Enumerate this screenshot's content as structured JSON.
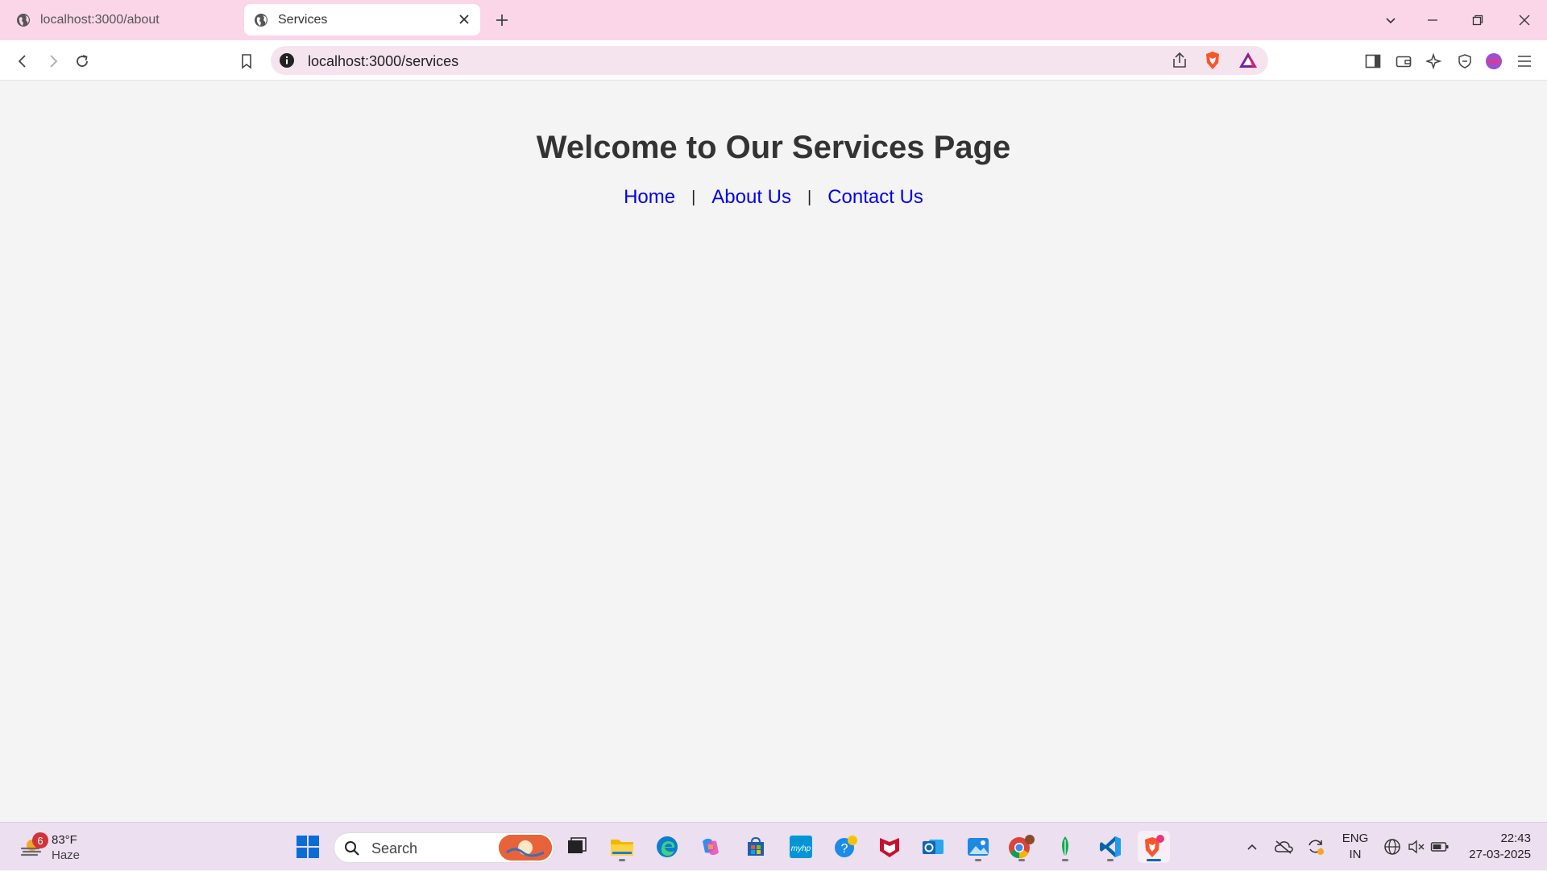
{
  "browser": {
    "tabs": [
      {
        "title": "localhost:3000/about",
        "active": false
      },
      {
        "title": "Services",
        "active": true
      }
    ],
    "address_bar": {
      "url": "localhost:3000/services"
    }
  },
  "page": {
    "heading": "Welcome to Our Services Page",
    "nav": {
      "home": "Home",
      "about": "About Us",
      "contact": "Contact Us",
      "separator": "|"
    }
  },
  "taskbar": {
    "weather": {
      "temperature": "83°F",
      "condition": "Haze",
      "badge": "6"
    },
    "search_placeholder": "Search",
    "language": {
      "line1": "ENG",
      "line2": "IN"
    },
    "clock": {
      "time": "22:43",
      "date": "27-03-2025"
    }
  },
  "colors": {
    "tabstrip": "#fbd6e9",
    "link": "#0000ee",
    "heading": "#333333",
    "page_bg": "#f4f4f4"
  }
}
